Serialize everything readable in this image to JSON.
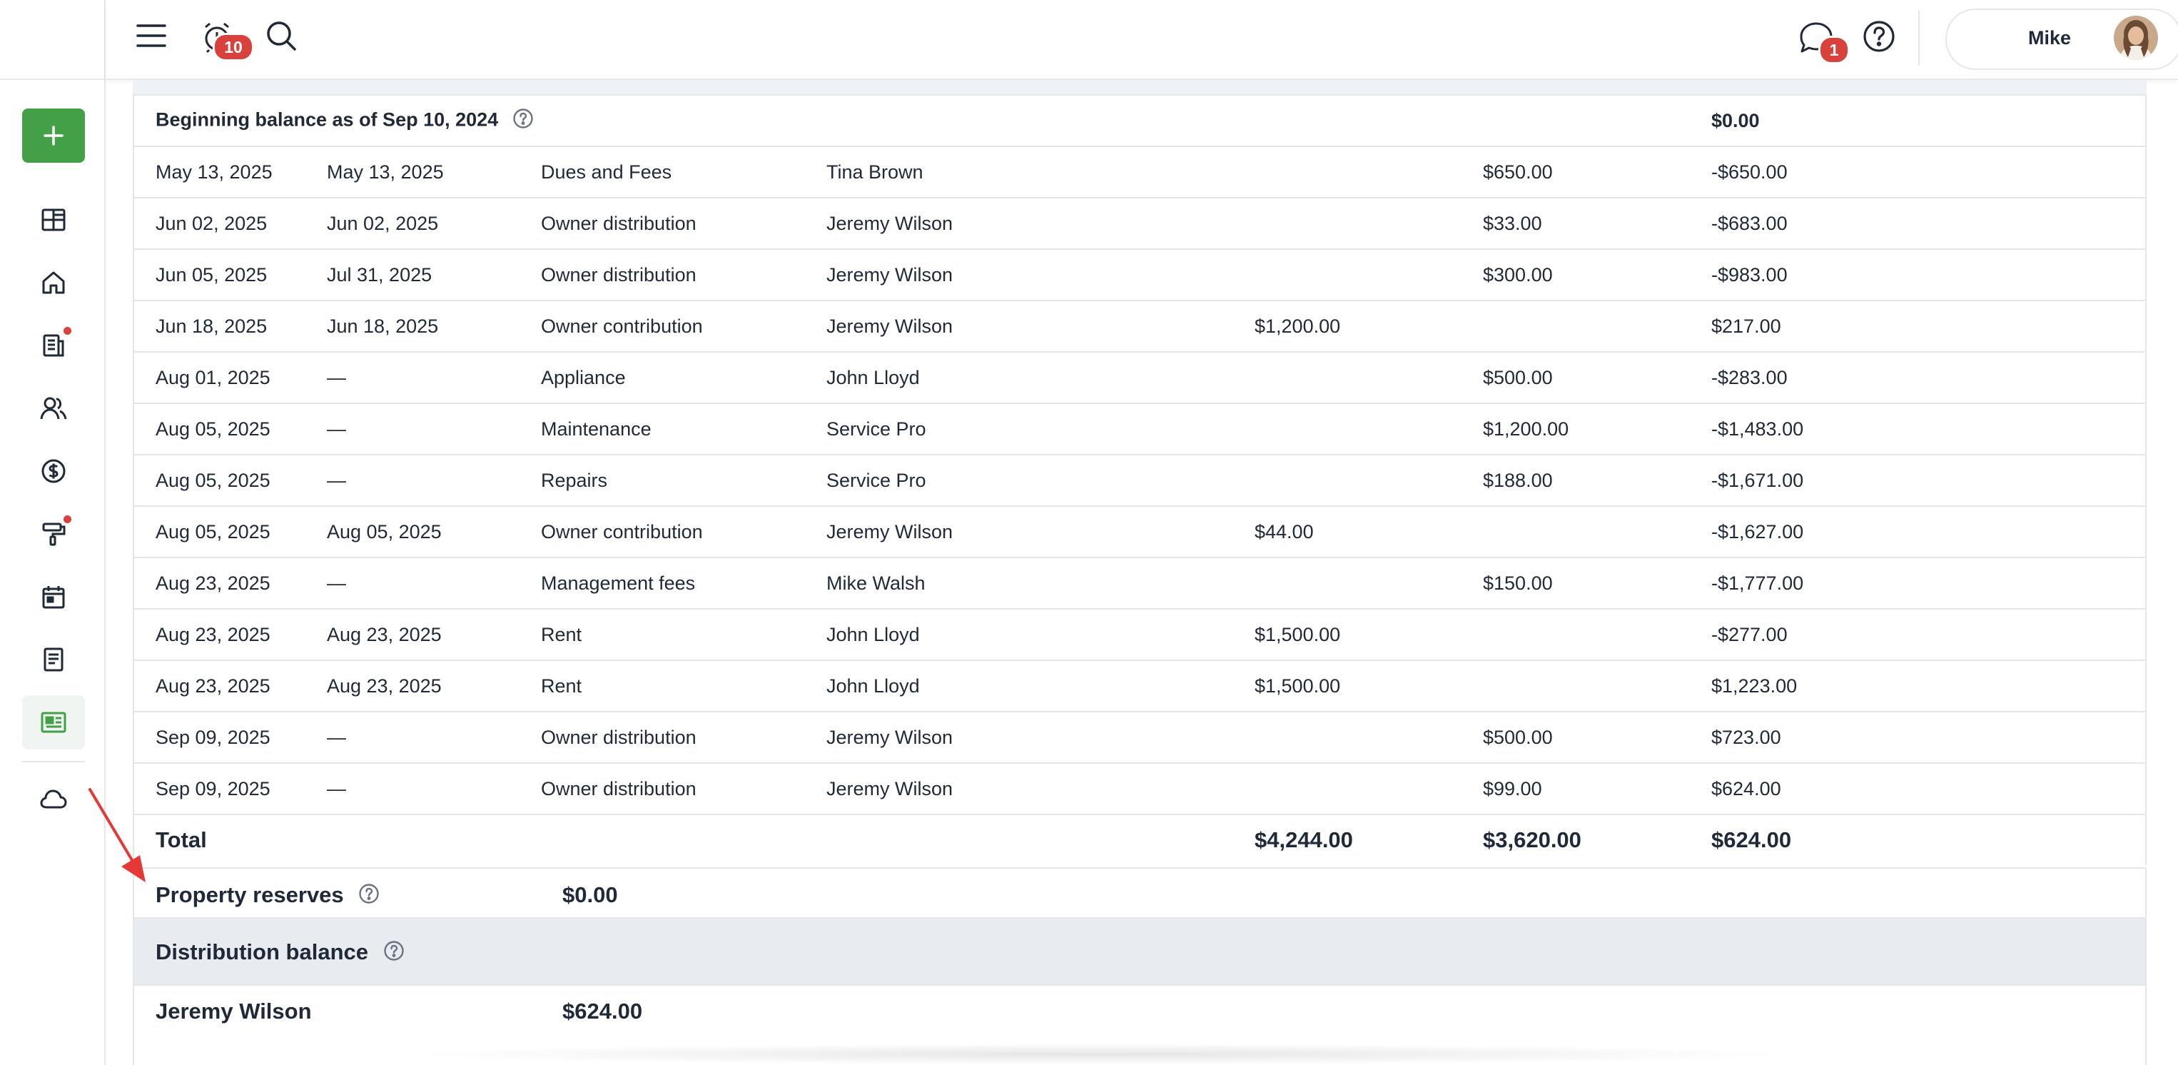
{
  "topbar": {
    "notifications_count": "10",
    "messages_count": "1",
    "user_name": "Mike"
  },
  "colors": {
    "accent_green": "#43a047",
    "badge_red": "#d9423c",
    "section_header_bg": "#e8ebef"
  },
  "sidebar": {
    "items": [
      {
        "name": "add-icon"
      },
      {
        "name": "dashboard-icon"
      },
      {
        "name": "home-icon"
      },
      {
        "name": "leases-icon",
        "has_dot": true
      },
      {
        "name": "people-icon"
      },
      {
        "name": "accounting-icon"
      },
      {
        "name": "maintenance-icon",
        "has_dot": true
      },
      {
        "name": "calendar-icon"
      },
      {
        "name": "documents-icon"
      },
      {
        "name": "reports-icon",
        "active": true
      },
      {
        "name": "cloud-icon"
      }
    ]
  },
  "ledger": {
    "beginning_balance_label": "Beginning balance as of Sep 10, 2024",
    "beginning_balance_value": "$0.00",
    "rows": [
      {
        "date": "May 13, 2025",
        "due": "May 13, 2025",
        "type": "Dues and Fees",
        "party": "Tina Brown",
        "in": "",
        "out": "$650.00",
        "balance": "-$650.00"
      },
      {
        "date": "Jun 02, 2025",
        "due": "Jun 02, 2025",
        "type": "Owner distribution",
        "party": "Jeremy Wilson",
        "in": "",
        "out": "$33.00",
        "balance": "-$683.00"
      },
      {
        "date": "Jun 05, 2025",
        "due": "Jul 31, 2025",
        "type": "Owner distribution",
        "party": "Jeremy Wilson",
        "in": "",
        "out": "$300.00",
        "balance": "-$983.00"
      },
      {
        "date": "Jun 18, 2025",
        "due": "Jun 18, 2025",
        "type": "Owner contribution",
        "party": "Jeremy Wilson",
        "in": "$1,200.00",
        "out": "",
        "balance": "$217.00"
      },
      {
        "date": "Aug 01, 2025",
        "due": "—",
        "type": "Appliance",
        "party": "John Lloyd",
        "in": "",
        "out": "$500.00",
        "balance": "-$283.00"
      },
      {
        "date": "Aug 05, 2025",
        "due": "—",
        "type": "Maintenance",
        "party": "Service Pro",
        "in": "",
        "out": "$1,200.00",
        "balance": "-$1,483.00"
      },
      {
        "date": "Aug 05, 2025",
        "due": "—",
        "type": "Repairs",
        "party": "Service Pro",
        "in": "",
        "out": "$188.00",
        "balance": "-$1,671.00"
      },
      {
        "date": "Aug 05, 2025",
        "due": "Aug 05, 2025",
        "type": "Owner contribution",
        "party": "Jeremy Wilson",
        "in": "$44.00",
        "out": "",
        "balance": "-$1,627.00"
      },
      {
        "date": "Aug 23, 2025",
        "due": "—",
        "type": "Management fees",
        "party": "Mike Walsh",
        "in": "",
        "out": "$150.00",
        "balance": "-$1,777.00"
      },
      {
        "date": "Aug 23, 2025",
        "due": "Aug 23, 2025",
        "type": "Rent",
        "party": "John Lloyd",
        "in": "$1,500.00",
        "out": "",
        "balance": "-$277.00"
      },
      {
        "date": "Aug 23, 2025",
        "due": "Aug 23, 2025",
        "type": "Rent",
        "party": "John Lloyd",
        "in": "$1,500.00",
        "out": "",
        "balance": "$1,223.00"
      },
      {
        "date": "Sep 09, 2025",
        "due": "—",
        "type": "Owner distribution",
        "party": "Jeremy Wilson",
        "in": "",
        "out": "$500.00",
        "balance": "$723.00"
      },
      {
        "date": "Sep 09, 2025",
        "due": "—",
        "type": "Owner distribution",
        "party": "Jeremy Wilson",
        "in": "",
        "out": "$99.00",
        "balance": "$624.00"
      }
    ],
    "total": {
      "label": "Total",
      "in": "$4,244.00",
      "out": "$3,620.00",
      "balance": "$624.00"
    }
  },
  "reserves": {
    "label": "Property reserves",
    "value": "$0.00"
  },
  "distribution": {
    "label": "Distribution balance",
    "owner_name": "Jeremy Wilson",
    "owner_value": "$624.00"
  }
}
